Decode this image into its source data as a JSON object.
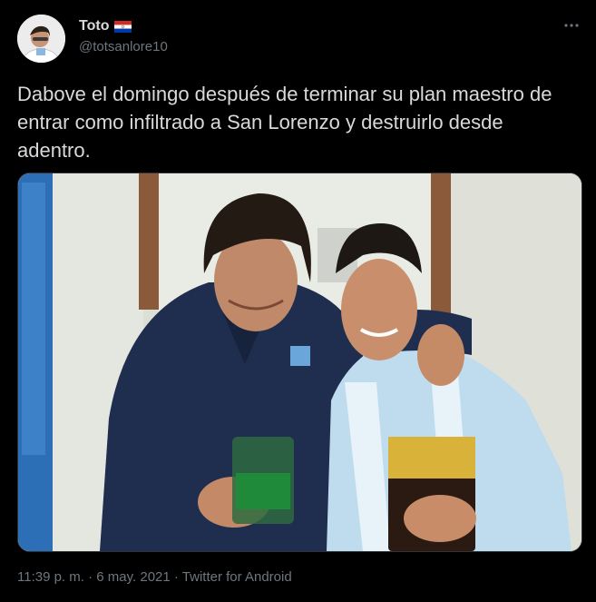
{
  "author": {
    "name": "Toto",
    "handle": "@totsanlore10",
    "flag": "paraguay-flag"
  },
  "tweet": {
    "text": "Dabove el domingo después de terminar su plan maestro de entrar como infiltrado a San Lorenzo y destruirlo desde adentro."
  },
  "meta": {
    "time": "11:39 p. m.",
    "separator1": " · ",
    "date": "6 may. 2021",
    "separator2": " · ",
    "source": "Twitter for Android"
  },
  "icons": {
    "more": "more-horizontal-icon"
  },
  "colors": {
    "background": "#000000",
    "text": "#d9d9d9",
    "secondary": "#6e767d",
    "border": "#2f3336"
  }
}
